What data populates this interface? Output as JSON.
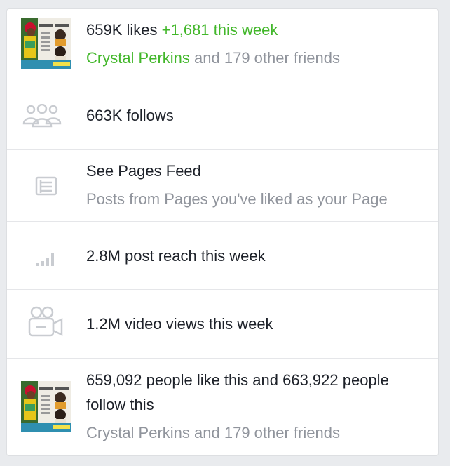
{
  "likes": {
    "count": "659K likes",
    "delta": "+1,681 this week",
    "friend_name": "Crystal Perkins",
    "friends_rest": "and 179 other friends"
  },
  "thumbnail": {
    "title": "GOD GOALS",
    "date": "MARCH 09 -19TH"
  },
  "follows": {
    "label": "663K follows",
    "icon": "people-icon"
  },
  "pages_feed": {
    "title": "See Pages Feed",
    "subtitle": "Posts from Pages you've liked as your Page",
    "icon": "feed-icon"
  },
  "reach": {
    "label": "2.8M post reach this week",
    "icon": "bar-chart-icon"
  },
  "video": {
    "label": "1.2M video views this week",
    "icon": "video-camera-icon"
  },
  "summary": {
    "line1": "659,092 people like this and 663,922 people",
    "line2": "follow this",
    "friend_name": "Crystal Perkins",
    "friends_rest": "and 179 other friends"
  },
  "colors": {
    "accent_green": "#42b72a",
    "text": "#1d2129",
    "secondary": "#90949c",
    "icon": "#c9ccd1"
  }
}
